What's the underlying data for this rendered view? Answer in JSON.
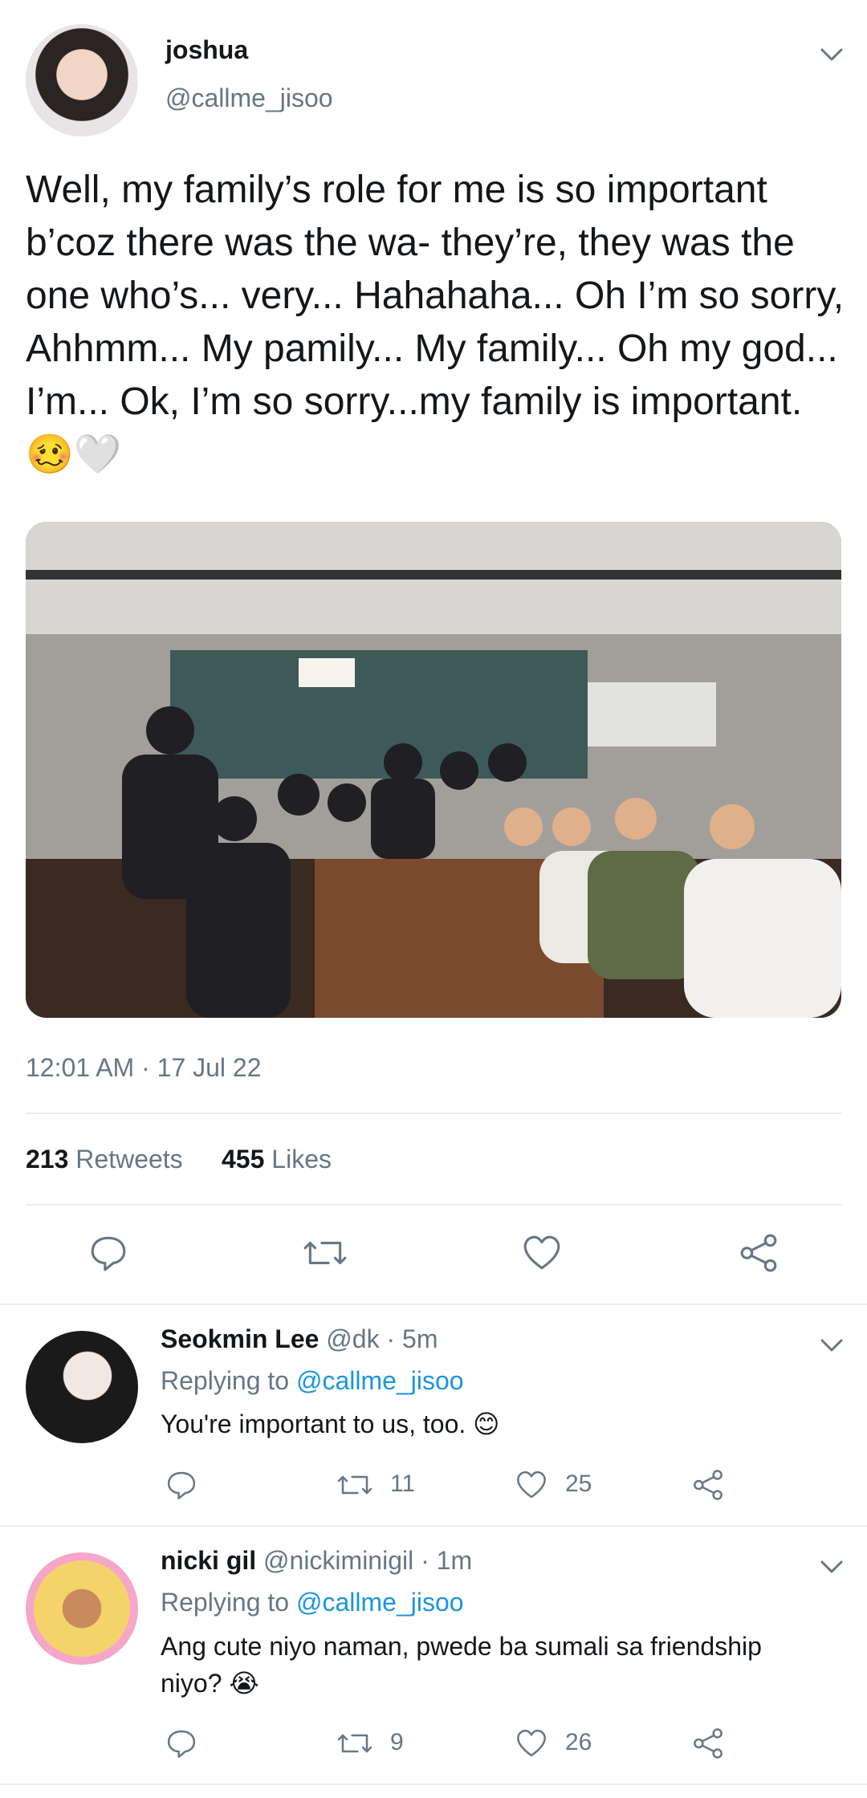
{
  "tweet": {
    "author_name": "joshua",
    "author_handle": "@callme_jisoo",
    "text": "Well, my family’s role for me is so important b’coz there was the wa- they’re, they was the one who’s... very... Hahahaha... Oh I’m so sorry, Ahhmm... My pamily... My family... Oh my god... I’m... Ok, I’m so sorry...my family is important.",
    "emojis": [
      "🥴",
      "🤍"
    ],
    "photo_alt": "group photo",
    "timestamp": "12:01 AM · 17 Jul 22",
    "retweets_count": "213",
    "retweets_label": "Retweets",
    "likes_count": "455",
    "likes_label": "Likes"
  },
  "replies": [
    {
      "name": "Seokmin Lee",
      "handle": "@dk",
      "time": "· 5m",
      "replying_label": "Replying to",
      "replying_handle": "@callme_jisoo",
      "text": "You're important to us, too. 😊",
      "retweets": "11",
      "likes": "25"
    },
    {
      "name": "nicki gil",
      "handle": "@nickiminigil",
      "time": "· 1m",
      "replying_label": "Replying to",
      "replying_handle": "@callme_jisoo",
      "text": "Ang cute niyo naman, pwede ba sumali sa friendship niyo? 😭",
      "retweets": "9",
      "likes": "26"
    }
  ],
  "colors": {
    "text": "#14171a",
    "muted": "#657786",
    "link": "#1b95e0",
    "divider": "#e6ecf0"
  },
  "icons": [
    "reply-icon",
    "retweet-icon",
    "like-icon",
    "share-icon",
    "chevron-down-icon"
  ]
}
